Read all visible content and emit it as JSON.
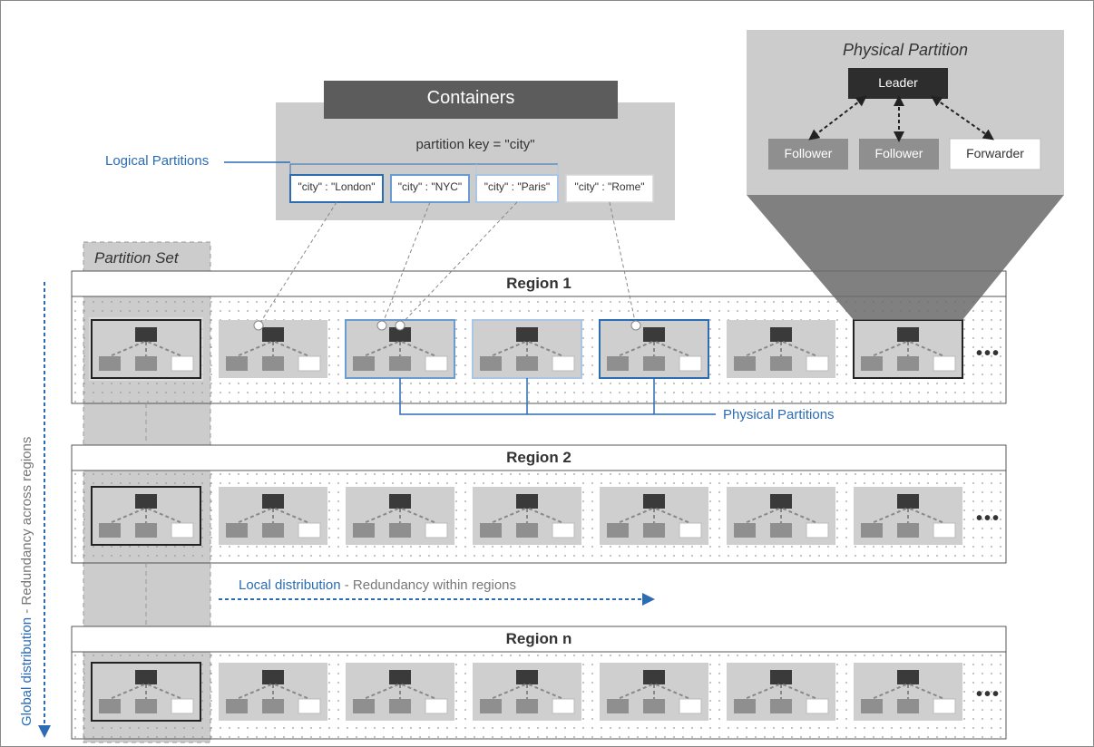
{
  "containers": {
    "title": "Containers",
    "pk_label": "partition key = \"city\"",
    "partitions": [
      {
        "label": "\"city\" : \"London\""
      },
      {
        "label": "\"city\" : \"NYC\""
      },
      {
        "label": "\"city\" : \"Paris\""
      },
      {
        "label": "\"city\" : \"Rome\""
      }
    ]
  },
  "labels": {
    "logical_partitions": "Logical Partitions",
    "partition_set": "Partition Set",
    "physical_partitions": "Physical Partitions",
    "global_distribution": "Global distribution",
    "global_distribution_sub": "  - Redundancy across regions",
    "local_distribution": "Local distribution",
    "local_distribution_sub": "  - Redundancy within regions",
    "ellipsis": "•••"
  },
  "physical_partition_inset": {
    "title": "Physical Partition",
    "leader": "Leader",
    "follower1": "Follower",
    "follower2": "Follower",
    "forwarder": "Forwarder"
  },
  "regions": [
    {
      "title": "Region 1"
    },
    {
      "title": "Region 2"
    },
    {
      "title": "Region n"
    }
  ]
}
